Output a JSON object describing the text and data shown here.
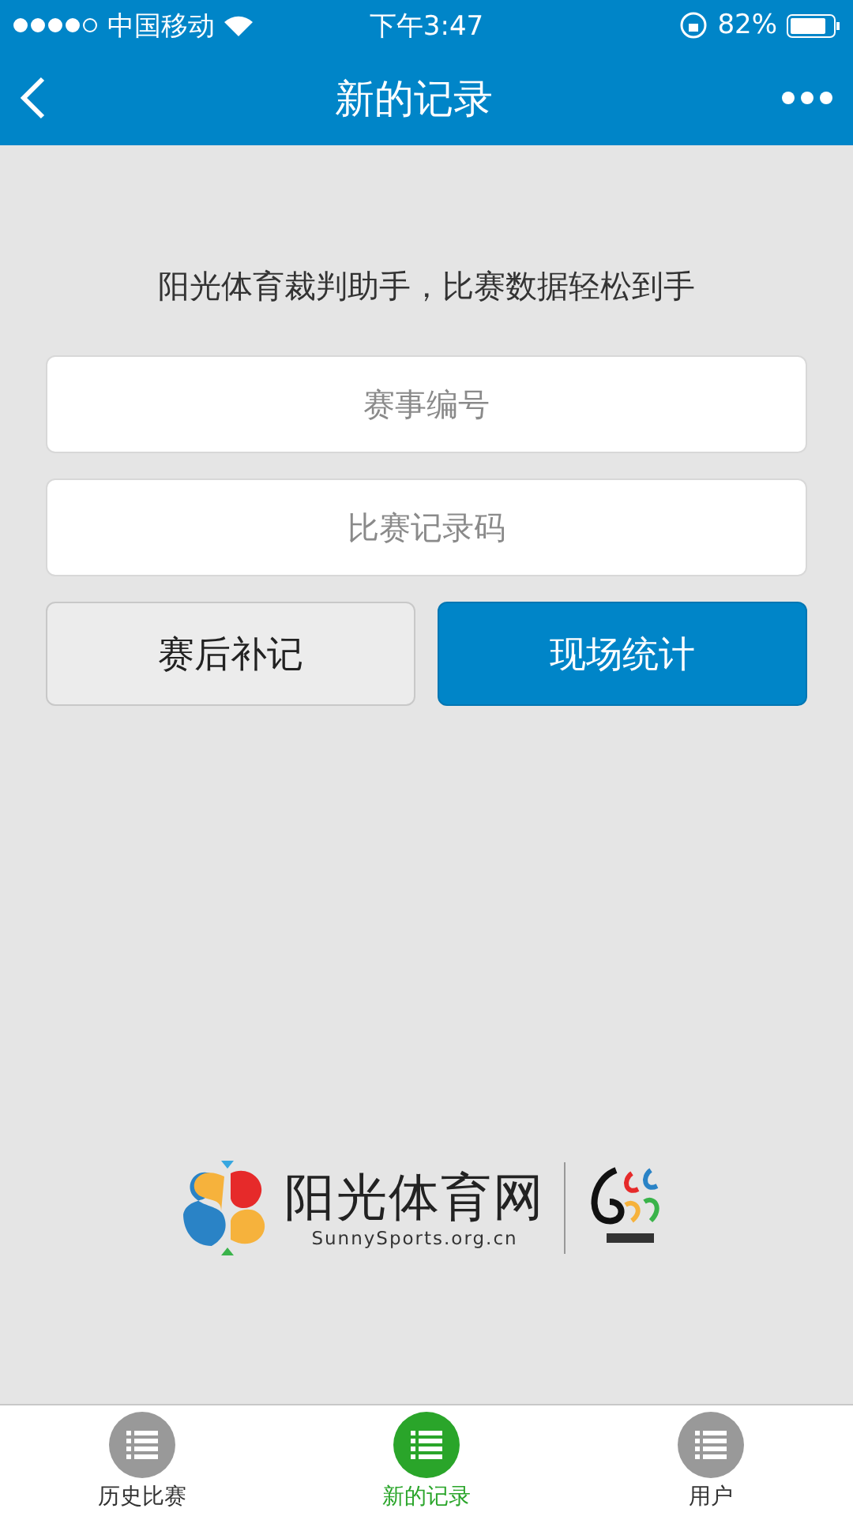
{
  "status_bar": {
    "carrier": "中国移动",
    "time": "下午3:47",
    "battery": "82%"
  },
  "nav": {
    "title": "新的记录"
  },
  "intro": "阳光体育裁判助手，比赛数据轻松到手",
  "fields": [
    {
      "placeholder": "赛事编号"
    },
    {
      "placeholder": "比赛记录码"
    }
  ],
  "buttons": [
    {
      "label": "赛后补记",
      "kind": "secondary"
    },
    {
      "label": "现场统计",
      "kind": "primary"
    }
  ],
  "brand": {
    "name": "阳光体育网",
    "url": "SunnySports.org.cn"
  },
  "tabs": [
    {
      "label": "历史比赛",
      "selected": false
    },
    {
      "label": "新的记录",
      "selected": true
    },
    {
      "label": "用户",
      "selected": false
    }
  ]
}
